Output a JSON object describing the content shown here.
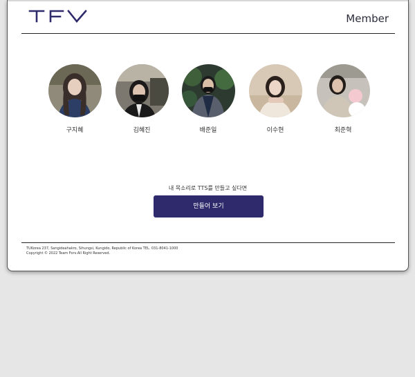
{
  "header": {
    "logo_text": "TFV",
    "nav_member": "Member"
  },
  "members": [
    {
      "name": "구지혜"
    },
    {
      "name": "김혜진"
    },
    {
      "name": "배준일"
    },
    {
      "name": "이수현"
    },
    {
      "name": "최준혁"
    }
  ],
  "cta": {
    "prompt": "내 목소리로 TTS를 만들고 싶다면",
    "button_label": "만들어 보기"
  },
  "footer": {
    "address": "TUKorea 237, Sangideahakro, Sihungsi, Kungido, Republic of Korea TEL. 031-8041-1000",
    "copyright": "Copyright © 2022 Team Forv.All Right Reserved."
  },
  "colors": {
    "brand": "#2e2a6b",
    "background": "#e6e6e6"
  }
}
